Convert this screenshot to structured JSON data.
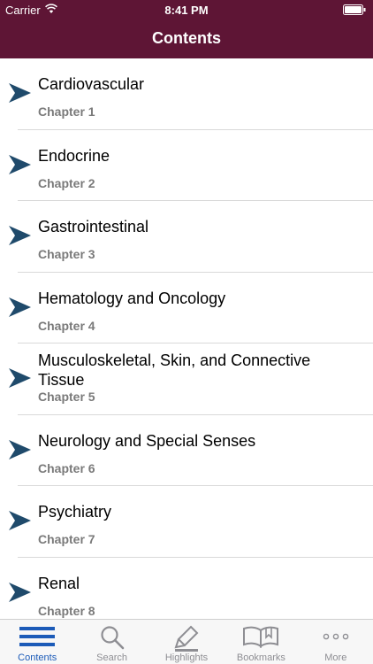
{
  "status": {
    "carrier": "Carrier",
    "time": "8:41 PM"
  },
  "nav": {
    "title": "Contents"
  },
  "chapters": [
    {
      "title": "Cardiovascular",
      "chapter": "Chapter 1"
    },
    {
      "title": "Endocrine",
      "chapter": "Chapter 2"
    },
    {
      "title": "Gastrointestinal",
      "chapter": "Chapter 3"
    },
    {
      "title": "Hematology and Oncology",
      "chapter": "Chapter 4"
    },
    {
      "title": "Musculoskeletal, Skin, and Connective Tissue",
      "chapter": "Chapter 5"
    },
    {
      "title": "Neurology and Special Senses",
      "chapter": "Chapter 6"
    },
    {
      "title": "Psychiatry",
      "chapter": "Chapter 7"
    },
    {
      "title": "Renal",
      "chapter": "Chapter 8"
    }
  ],
  "tabs": [
    {
      "label": "Contents",
      "icon": "list-icon"
    },
    {
      "label": "Search",
      "icon": "search-icon"
    },
    {
      "label": "Highlights",
      "icon": "highlighter-icon"
    },
    {
      "label": "Bookmarks",
      "icon": "book-icon"
    },
    {
      "label": "More",
      "icon": "more-icon"
    }
  ],
  "colors": {
    "header": "#5e1535",
    "accent": "#1c5bb8",
    "arrow": "#1f4a6b"
  }
}
